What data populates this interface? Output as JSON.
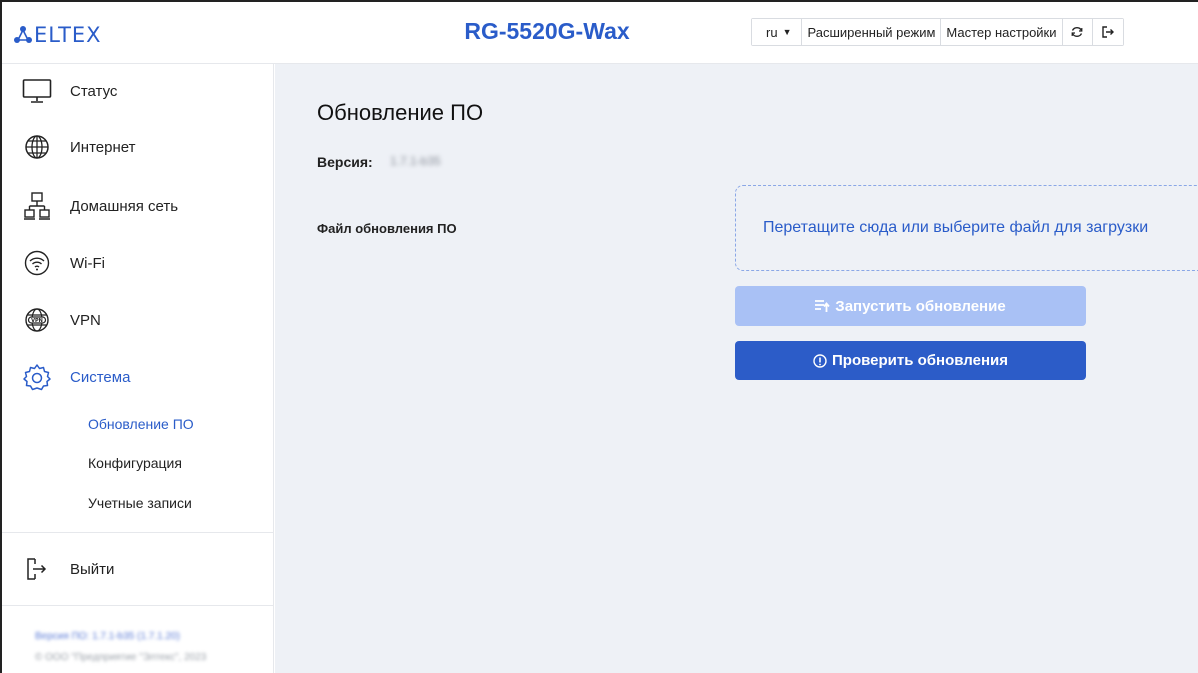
{
  "header": {
    "logo_text": "ELTEX",
    "device_title": "RG-5520G-Wax",
    "toolbar": {
      "language": "ru",
      "advanced_mode": "Расширенный режим",
      "setup_wizard": "Мастер настройки"
    }
  },
  "sidebar": {
    "items": [
      {
        "label": "Статус",
        "icon": "monitor-icon"
      },
      {
        "label": "Интернет",
        "icon": "globe-icon"
      },
      {
        "label": "Домашняя сеть",
        "icon": "network-icon"
      },
      {
        "label": "Wi-Fi",
        "icon": "wifi-icon"
      },
      {
        "label": "VPN",
        "icon": "vpn-globe-icon"
      },
      {
        "label": "Система",
        "icon": "gear-icon"
      }
    ],
    "subitems": [
      {
        "label": "Обновление ПО"
      },
      {
        "label": "Конфигурация"
      },
      {
        "label": "Учетные записи"
      }
    ],
    "logout": "Выйти",
    "footer": {
      "version": "Версия ПО: 1.7.1-b35 (1.7.1.20)",
      "copyright": "© ООО \"Предприятие \"Элтекс\", 2023"
    }
  },
  "main": {
    "title": "Обновление ПО",
    "version_label": "Версия:",
    "version_value": "1.7.1-b35",
    "file_label": "Файл обновления ПО",
    "dropzone_text": "Перетащите сюда или выберите файл для загрузки",
    "start_update": "Запустить обновление",
    "check_updates": "Проверить обновления"
  },
  "colors": {
    "brand": "#2a5cc9",
    "primary_button": "#2c5cc8",
    "disabled_button": "#a9c1f5",
    "content_background": "#eef1f6"
  }
}
